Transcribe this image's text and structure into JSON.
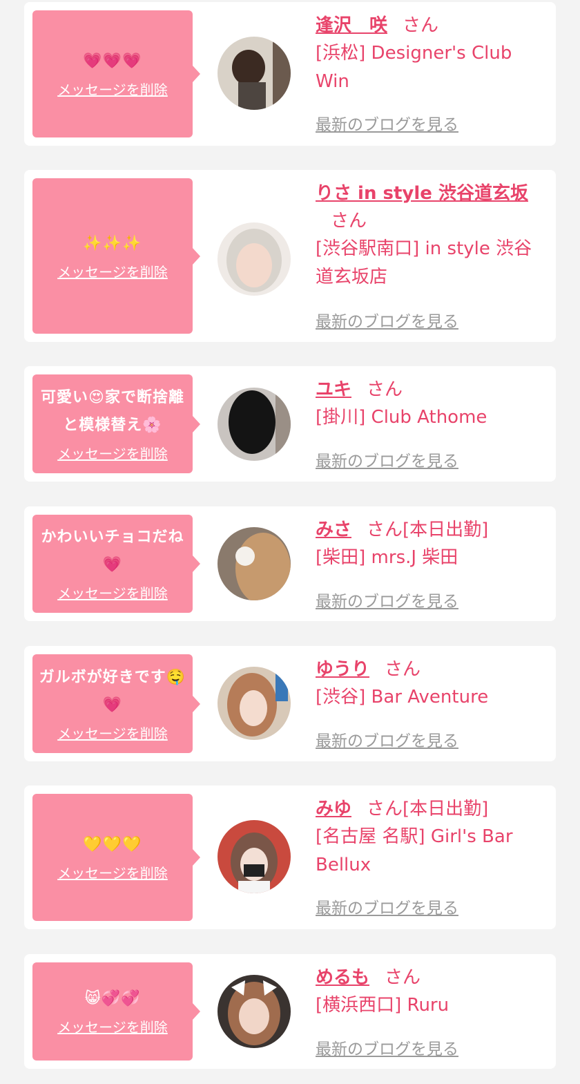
{
  "cards": [
    {
      "message": "💗💗💗",
      "delete_label": "メッセージを削除",
      "name": "逢沢　咲",
      "honorific": "さん",
      "shop": "[浜松] Designer's Club Win",
      "blog_label": "最新のブログを見る"
    },
    {
      "message": "✨✨✨",
      "delete_label": "メッセージを削除",
      "name": "りさ in style 渋谷道玄坂",
      "honorific": "さん",
      "shop": "[渋谷駅南口] in style 渋谷道玄坂店",
      "blog_label": "最新のブログを見る"
    },
    {
      "message": "可愛い😍家で断捨離と模様替え🌸",
      "delete_label": "メッセージを削除",
      "name": "ユキ",
      "honorific": "さん",
      "shop": "[掛川] Club Athome",
      "blog_label": "最新のブログを見る"
    },
    {
      "message": "かわいいチョコだね💗",
      "delete_label": "メッセージを削除",
      "name": "みさ",
      "honorific": "さん[本日出勤]",
      "shop": "[柴田] mrs.J 柴田",
      "blog_label": "最新のブログを見る"
    },
    {
      "message": "ガルボが好きです🤤💗",
      "delete_label": "メッセージを削除",
      "name": "ゆうり",
      "honorific": "さん",
      "shop": "[渋谷] Bar Aventure",
      "blog_label": "最新のブログを見る"
    },
    {
      "message": "💛💛💛",
      "delete_label": "メッセージを削除",
      "name": "みゆ",
      "honorific": "さん[本日出勤]",
      "shop": "[名古屋 名駅] Girl's Bar Bellux",
      "blog_label": "最新のブログを見る"
    },
    {
      "message": "😸💞💞",
      "delete_label": "メッセージを削除",
      "name": "めるも",
      "honorific": "さん",
      "shop": "[横浜西口] Ruru",
      "blog_label": "最新のブログを見る"
    }
  ],
  "colors": {
    "accent": "#e8436a",
    "bubble": "#fa8fa4",
    "background": "#f3f3f3"
  }
}
